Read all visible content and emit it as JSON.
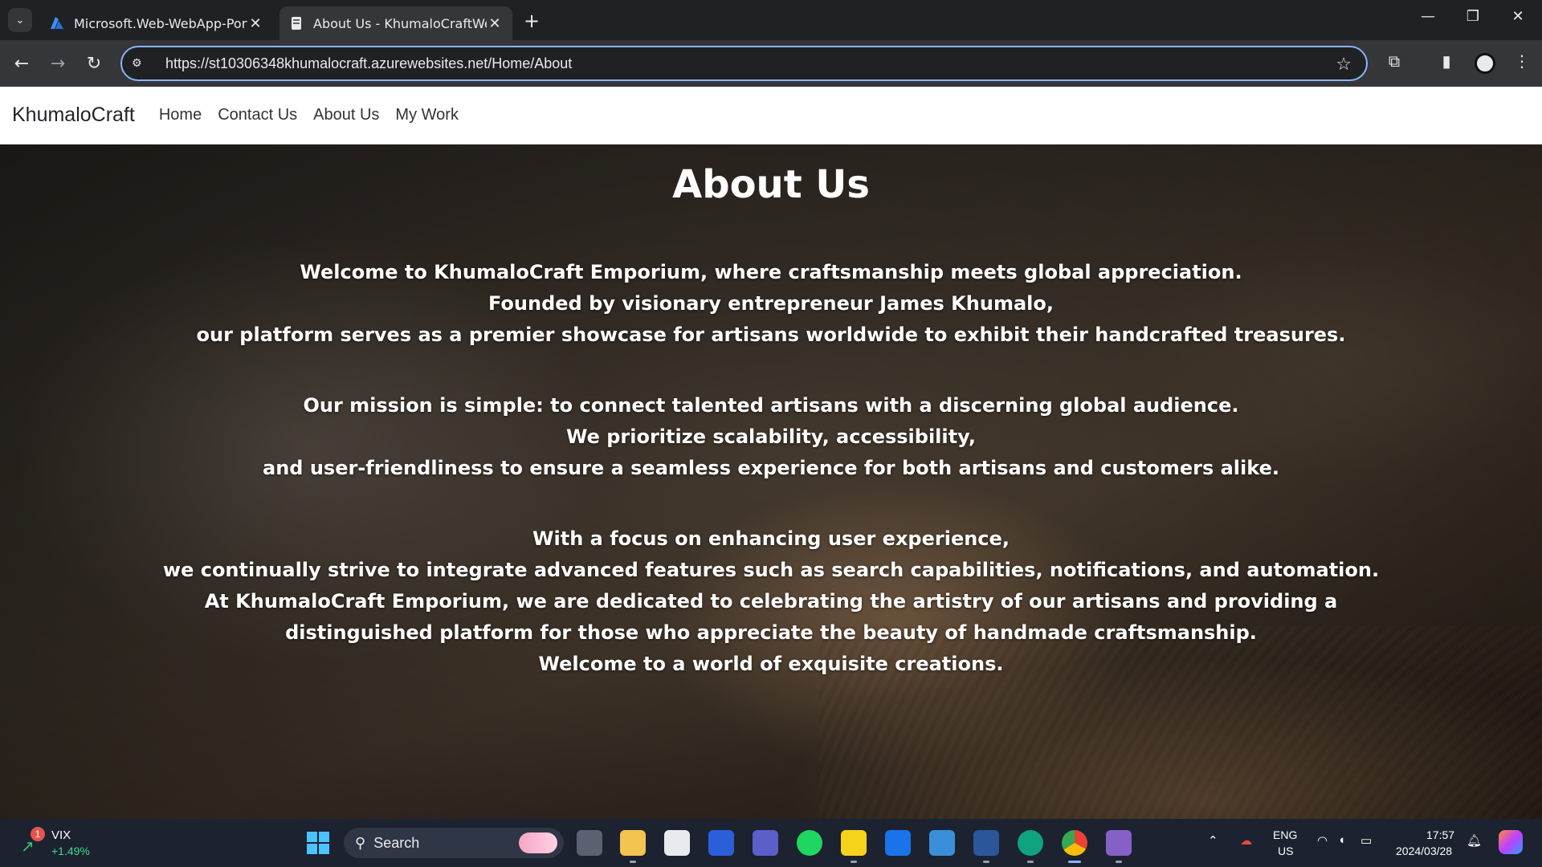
{
  "browser": {
    "tabs": [
      {
        "title": "Microsoft.Web-WebApp-Portal",
        "active": false
      },
      {
        "title": "About Us - KhumaloCraftWebA",
        "active": true
      }
    ],
    "url": "https://st10306348khumalocraft.azurewebsites.net/Home/About"
  },
  "site": {
    "brand": "KhumaloCraft",
    "nav": [
      "Home",
      "Contact Us",
      "About Us",
      "My Work"
    ]
  },
  "about": {
    "heading": "About Us",
    "para1": [
      "Welcome to KhumaloCraft Emporium, where craftsmanship meets global appreciation.",
      "Founded by visionary entrepreneur James Khumalo,",
      "our platform serves as a premier showcase for artisans worldwide to exhibit their handcrafted treasures."
    ],
    "para2": [
      "Our mission is simple: to connect talented artisans with a discerning global audience.",
      "We prioritize scalability, accessibility,",
      "and user-friendliness to ensure a seamless experience for both artisans and customers alike."
    ],
    "para3": [
      "With a focus on enhancing user experience,",
      "we continually strive to integrate advanced features such as search capabilities, notifications, and automation.",
      "At KhumaloCraft Emporium, we are dedicated to celebrating the artistry of our artisans and providing a",
      "distinguished platform for those who appreciate the beauty of handmade craftsmanship.",
      "Welcome to a world of exquisite creations."
    ]
  },
  "taskbar": {
    "widget": {
      "badge": "1",
      "name": "VIX",
      "change": "+1.49%"
    },
    "search_label": "Search",
    "lang_top": "ENG",
    "lang_bottom": "US",
    "time": "17:57",
    "date": "2024/03/28"
  },
  "icons": {
    "tab_search": "chevron-down-icon",
    "azure": "azure-logo-icon",
    "page": "page-icon",
    "close": "close-icon",
    "new_tab": "plus-icon",
    "back": "back-arrow-icon",
    "forward": "forward-arrow-icon",
    "reload": "reload-icon",
    "site_info": "tune-icon",
    "bookmark": "star-icon",
    "extensions": "puzzle-icon",
    "side_panel": "side-panel-icon",
    "menu": "kebab-menu-icon"
  },
  "colors": {
    "omnibox_focus": "#8ab4f8",
    "chrome_dark": "#202124",
    "chrome_toolbar": "#35363a",
    "taskbar": "#1c2230",
    "hero_text": "#ffffff"
  }
}
